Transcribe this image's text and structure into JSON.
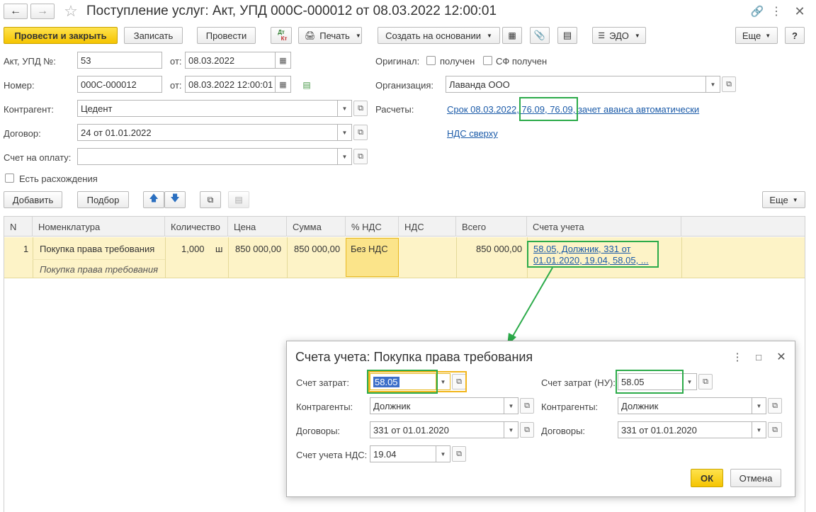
{
  "window": {
    "title": "Поступление услуг: Акт, УПД 000С-000012 от 08.03.2022 12:00:01"
  },
  "toolbar": {
    "post_close": "Провести и закрыть",
    "save": "Записать",
    "post": "Провести",
    "dtkt_top": "Дт",
    "dtkt_bottom": "Кт",
    "print": "Печать",
    "create_based": "Создать на основании",
    "edo": "ЭДО",
    "more": "Еще",
    "help": "?"
  },
  "form": {
    "act_label": "Акт, УПД №:",
    "act_value": "53",
    "from_label": "от:",
    "act_date": "08.03.2022",
    "number_label": "Номер:",
    "number_value": "000С-000012",
    "from_label2": "от:",
    "number_date": "08.03.2022 12:00:01",
    "original_label": "Оригинал:",
    "received_label": "получен",
    "sf_received_label": "СФ получен",
    "org_label": "Организация:",
    "org_value": "Лаванда ООО",
    "counterparty_label": "Контрагент:",
    "counterparty_value": "Цедент",
    "settlements_label": "Расчеты:",
    "settlements_link": "Срок 08.03.2022, 76.09, 76.09, зачет аванса автоматически",
    "contract_label": "Договор:",
    "contract_value": "24 от 01.01.2022",
    "vat_link": "НДС сверху",
    "invoice_label": "Счет на оплату:",
    "invoice_value": "",
    "discrepancy_label": "Есть расхождения"
  },
  "table_toolbar": {
    "add": "Добавить",
    "select": "Подбор",
    "more": "Еще"
  },
  "table": {
    "headers": [
      "N",
      "Номенклатура",
      "Количество",
      "Цена",
      "Сумма",
      "% НДС",
      "НДС",
      "Всего",
      "Счета учета"
    ],
    "row": {
      "n": "1",
      "name": "Покупка права требования",
      "name_sub": "Покупка права требования",
      "qty": "1,000",
      "unit": "ш",
      "price": "850 000,00",
      "sum": "850 000,00",
      "vat_rate": "Без НДС",
      "vat": "",
      "total": "850 000,00",
      "accounts_line1": "58.05, Должник, 331 от",
      "accounts_line2": "01.01.2020, 19.04, 58.05, ..."
    }
  },
  "dialog": {
    "title": "Счета учета: Покупка права требования",
    "cost_account_label": "Счет затрат:",
    "cost_account_value": "58.05",
    "cost_account_nu_label": "Счет затрат (НУ):",
    "cost_account_nu_value": "58.05",
    "counterparties_label": "Контрагенты:",
    "counterparties_value": "Должник",
    "counterparties_label2": "Контрагенты:",
    "counterparties_value2": "Должник",
    "contracts_label": "Договоры:",
    "contracts_value": "331 от 01.01.2020",
    "contracts_label2": "Договоры:",
    "contracts_value2": "331 от 01.01.2020",
    "vat_account_label": "Счет учета НДС:",
    "vat_account_value": "19.04",
    "ok": "ОК",
    "cancel": "Отмена"
  },
  "colors": {
    "accent_yellow": "#f5c400",
    "highlight_green": "#2cab4a",
    "highlight_orange": "#f2b61d",
    "selected_row": "#fdf3c7",
    "link": "#1a5aa8"
  }
}
